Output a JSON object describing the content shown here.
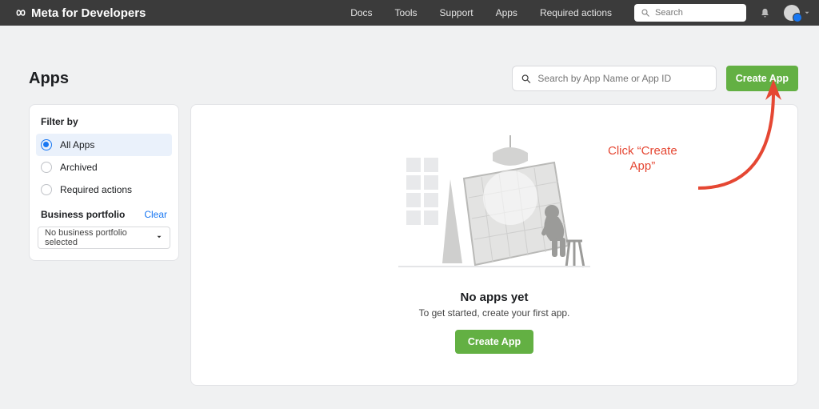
{
  "nav": {
    "brand": "Meta for Developers",
    "links": [
      "Docs",
      "Tools",
      "Support",
      "Apps",
      "Required actions"
    ],
    "search_placeholder": "Search"
  },
  "page": {
    "title": "Apps",
    "app_search_placeholder": "Search by App Name or App ID",
    "create_button": "Create App"
  },
  "sidebar": {
    "filter_title": "Filter by",
    "filters": [
      {
        "label": "All Apps",
        "selected": true
      },
      {
        "label": "Archived",
        "selected": false
      },
      {
        "label": "Required actions",
        "selected": false
      }
    ],
    "portfolio_title": "Business portfolio",
    "clear": "Clear",
    "portfolio_value": "No business portfolio selected"
  },
  "empty": {
    "title": "No apps yet",
    "subtitle": "To get started, create your first app.",
    "button": "Create App"
  },
  "annotation": {
    "text": "Click “Create\nApp”"
  }
}
